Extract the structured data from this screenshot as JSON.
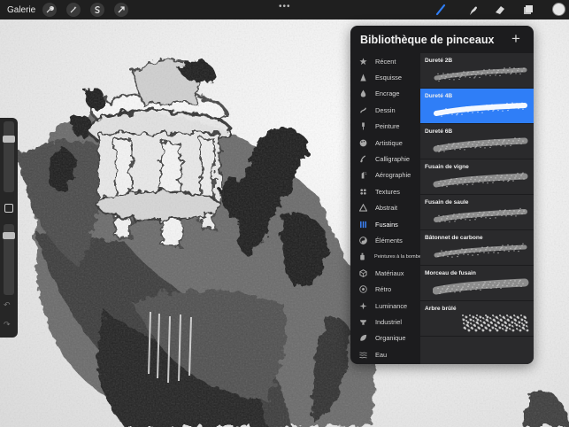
{
  "topbar": {
    "gallery_label": "Galerie",
    "left_tools": [
      "wrench-icon",
      "magic-wand-icon",
      "selection-icon",
      "transform-arrow-icon"
    ],
    "more_label": "•••",
    "right_tools": [
      "brush-icon",
      "smudge-icon",
      "eraser-icon",
      "layers-icon",
      "color-icon"
    ],
    "accent_color": "#2f7ef7"
  },
  "sidebar": {
    "size_level": 0.78,
    "opacity_level": 0.12
  },
  "brush_library": {
    "title": "Bibliothèque de pinceaux",
    "add_label": "+",
    "categories": [
      {
        "label": "Récent",
        "icon": "star-icon"
      },
      {
        "label": "Esquisse",
        "icon": "pencil-tip-icon"
      },
      {
        "label": "Encrage",
        "icon": "ink-drop-icon"
      },
      {
        "label": "Dessin",
        "icon": "squiggle-icon"
      },
      {
        "label": "Peinture",
        "icon": "paint-brush-icon"
      },
      {
        "label": "Artistique",
        "icon": "palette-icon"
      },
      {
        "label": "Calligraphie",
        "icon": "calligraphy-icon"
      },
      {
        "label": "Aérographie",
        "icon": "airbrush-icon"
      },
      {
        "label": "Textures",
        "icon": "texture-icon"
      },
      {
        "label": "Abstrait",
        "icon": "triangle-icon"
      },
      {
        "label": "Fusains",
        "icon": "charcoal-icon"
      },
      {
        "label": "Éléments",
        "icon": "yin-yang-icon"
      },
      {
        "label": "Peintures à la bombe",
        "icon": "spray-can-icon"
      },
      {
        "label": "Matériaux",
        "icon": "cube-icon"
      },
      {
        "label": "Rétro",
        "icon": "retro-icon"
      },
      {
        "label": "Luminance",
        "icon": "sparkle-icon"
      },
      {
        "label": "Industriel",
        "icon": "anvil-icon"
      },
      {
        "label": "Organique",
        "icon": "leaf-icon"
      },
      {
        "label": "Eau",
        "icon": "waves-icon"
      }
    ],
    "selected_category": "Fusains",
    "brushes": [
      {
        "name": "Dureté 2B"
      },
      {
        "name": "Dureté 4B"
      },
      {
        "name": "Dureté 6B"
      },
      {
        "name": "Fusain de vigne"
      },
      {
        "name": "Fusain de saule"
      },
      {
        "name": "Bâtonnet de carbone"
      },
      {
        "name": "Morceau de fusain"
      },
      {
        "name": "Arbre brûlé"
      }
    ],
    "selected_brush": "Dureté 4B"
  }
}
